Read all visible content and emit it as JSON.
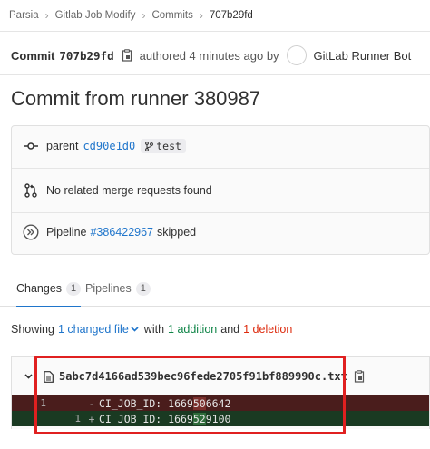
{
  "breadcrumb": {
    "items": [
      "Parsia",
      "Gitlab Job Modify",
      "Commits",
      "707b29fd"
    ],
    "separator": ">"
  },
  "commit_header": {
    "label": "Commit",
    "sha": "707b29fd",
    "authored": "authored 4 minutes ago by",
    "author": "GitLab Runner Bot",
    "copy_icon": "copy-icon"
  },
  "title": "Commit from runner 380987",
  "info": {
    "parent_label": "parent",
    "parent_sha": "cd90e1d0",
    "branch": "test",
    "merge_requests": "No related merge requests found",
    "pipeline_label": "Pipeline",
    "pipeline_id": "#386422967",
    "pipeline_status": "skipped"
  },
  "tabs": [
    {
      "label": "Changes",
      "count": "1"
    },
    {
      "label": "Pipelines",
      "count": "1"
    }
  ],
  "stats": {
    "showing": "Showing",
    "changed": "1 changed file",
    "with": "with",
    "additions": "1 addition",
    "and": "and",
    "deletions": "1 deletion"
  },
  "diff": {
    "filename": "5abc7d4166ad539bec96fede2705f91bf889990c.txt",
    "lines": [
      {
        "old": "1",
        "new": "",
        "marker": "-",
        "prefix": "CI_JOB_ID: 1669",
        "changed": "50",
        "suffix": "6642",
        "type": "del"
      },
      {
        "old": "",
        "new": "1",
        "marker": "+",
        "prefix": "CI_JOB_ID: 1669",
        "changed": "52",
        "suffix": "9100",
        "type": "add"
      }
    ]
  },
  "colors": {
    "link": "#1f75cb",
    "addition": "#108548",
    "deletion": "#dd2b0e",
    "highlight_box": "#e02020"
  }
}
